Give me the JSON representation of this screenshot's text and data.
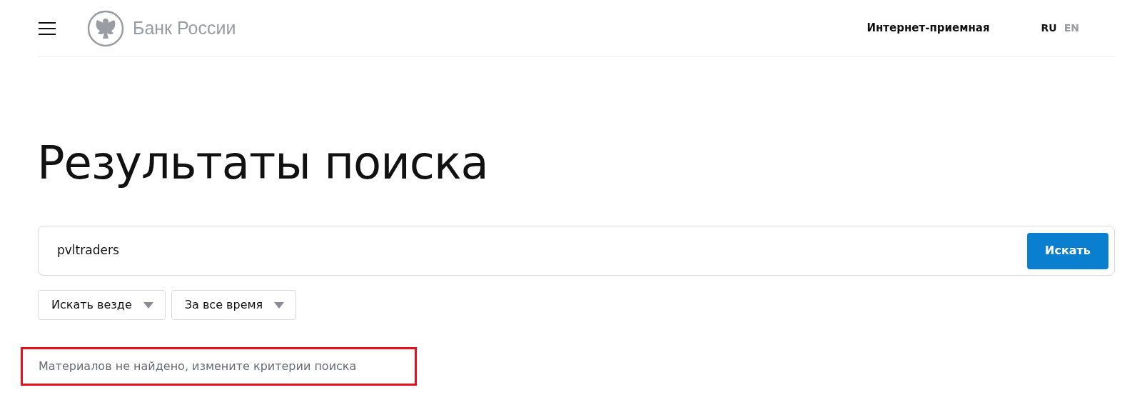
{
  "header": {
    "logo_text": "Банк России",
    "link": "Интернет-приемная",
    "languages": [
      {
        "label": "RU",
        "selected": true
      },
      {
        "label": "EN",
        "selected": false
      }
    ]
  },
  "title": "Результаты поиска",
  "search": {
    "value": "pvltraders",
    "button": "Искать"
  },
  "filters": [
    {
      "label": "Искать везде"
    },
    {
      "label": "За все время"
    }
  ],
  "message": {
    "text": "Материалов не найдено, измените критерии поиска",
    "highlighted": true
  }
}
